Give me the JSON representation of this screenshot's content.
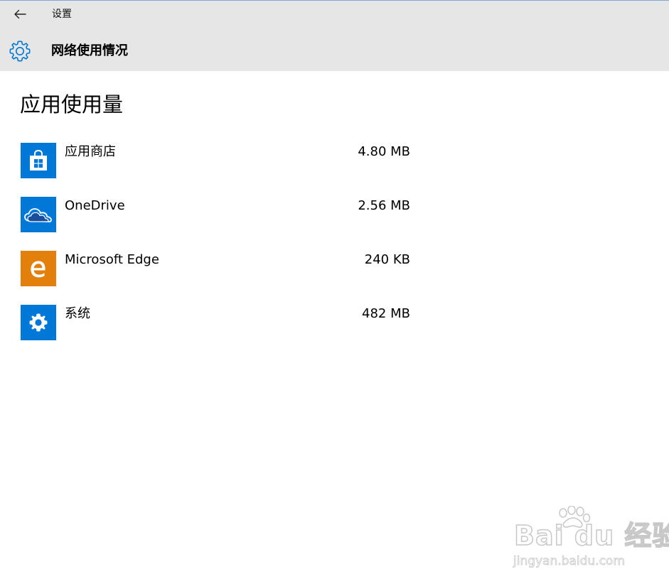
{
  "window": {
    "title": "设置",
    "back_icon": "back-arrow-icon"
  },
  "header": {
    "title": "网络使用情况",
    "icon": "gear-icon",
    "accent_color": "#0078d7",
    "background_color": "#e6e6e6"
  },
  "section": {
    "title": "应用使用量"
  },
  "apps": [
    {
      "name": "应用商店",
      "usage": "4.80 MB",
      "icon": "store-bag-icon",
      "tile_color": "#0078d7"
    },
    {
      "name": "OneDrive",
      "usage": "2.56 MB",
      "icon": "cloud-icon",
      "tile_color": "#0078d7"
    },
    {
      "name": "Microsoft Edge",
      "usage": "240 KB",
      "icon": "edge-e-icon",
      "tile_color": "#e3800c"
    },
    {
      "name": "系统",
      "usage": "482 MB",
      "icon": "gear-icon",
      "tile_color": "#0078d7"
    }
  ],
  "watermark": {
    "logo_text": "Bai du 经验",
    "url": "jingyan.baidu.com"
  }
}
